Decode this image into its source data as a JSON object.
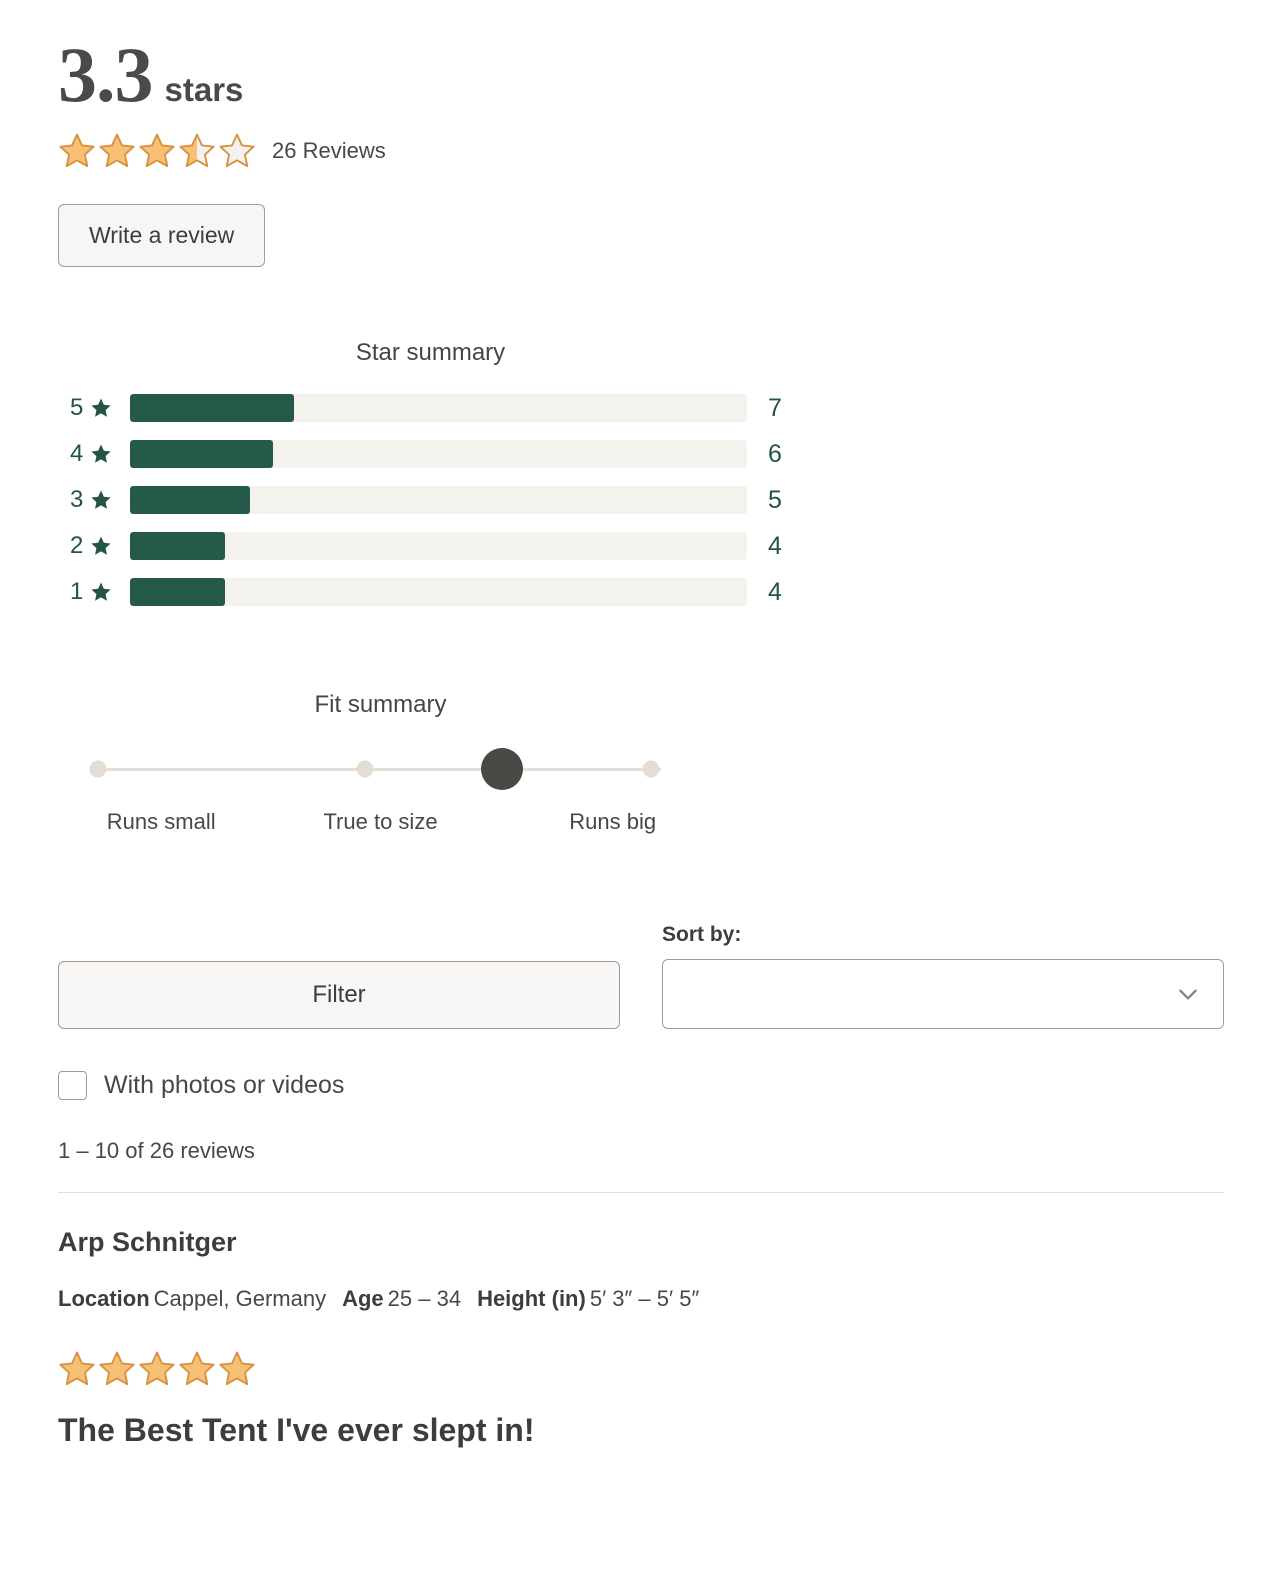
{
  "colors": {
    "star_fill": "#F6C177",
    "star_stroke": "#D79240",
    "star_empty": "#F4F2EE",
    "bar_fill": "#255A49",
    "bar_track": "#F3F2ED",
    "green_text": "#245446",
    "dot_idle": "#E3DDD5",
    "dot_selected": "#4A4845",
    "button_bg": "#F8F7F5",
    "border": "#A49C94"
  },
  "summary": {
    "score": "3.3",
    "score_unit": "stars",
    "stars_filled": 3.5,
    "reviews_count_label": "26 Reviews",
    "write_review_label": "Write a review"
  },
  "star_summary": {
    "title": "Star summary",
    "star_icon": "star-icon",
    "rows": [
      {
        "stars": "5",
        "count": "7",
        "pct": 26.6
      },
      {
        "stars": "4",
        "count": "6",
        "pct": 23.1
      },
      {
        "stars": "3",
        "count": "5",
        "pct": 19.4
      },
      {
        "stars": "2",
        "count": "4",
        "pct": 15.4
      },
      {
        "stars": "1",
        "count": "4",
        "pct": 15.4
      }
    ]
  },
  "fit_summary": {
    "title": "Fit summary",
    "dots": [
      {
        "x_pct": 6.2,
        "selected": false
      },
      {
        "x_pct": 47.6,
        "selected": false
      },
      {
        "x_pct": 68.9,
        "selected": true
      },
      {
        "x_pct": 92.0,
        "selected": false
      }
    ],
    "labels": [
      {
        "text": "Runs small",
        "x_pct": 16.0
      },
      {
        "text": "True to size",
        "x_pct": 50.0
      },
      {
        "text": "Runs big",
        "x_pct": 86.0
      }
    ]
  },
  "controls": {
    "filter_label": "Filter",
    "sort_label": "Sort by:",
    "sort_value": "",
    "chevron_icon": "chevron-down-icon"
  },
  "filters": {
    "photos_videos_label": "With photos or videos",
    "photos_videos_checked": false
  },
  "results": {
    "range_label": "1 – 10 of 26 reviews"
  },
  "review": {
    "author": "Arp Schnitger",
    "meta": [
      {
        "key": "Location",
        "value": "Cappel, Germany"
      },
      {
        "key": "Age",
        "value": "25 – 34"
      },
      {
        "key": "Height (in)",
        "value": "5′ 3″ – 5′ 5″"
      }
    ],
    "rating": 5,
    "title": "The Best Tent I've ever slept in!"
  }
}
